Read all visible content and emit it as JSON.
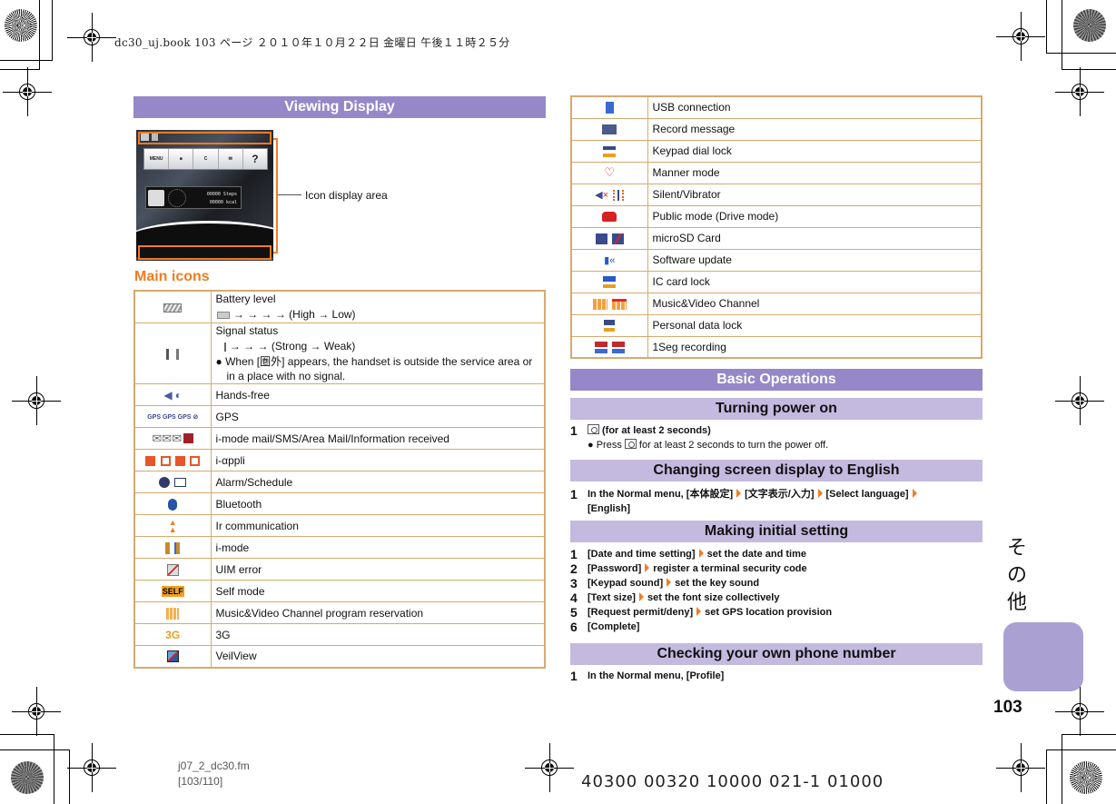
{
  "print_header": "dc30_uj.book   103 ページ   ２０１０年１０月２２日   金曜日   午後１１時２５分",
  "viewing_display": {
    "banner": "Viewing Display",
    "phone_menu": [
      "MENU",
      "■",
      "C",
      "✉",
      "?"
    ],
    "widget_steps": "00000 Steps",
    "widget_kcal": "00000 kcal",
    "callout_label": "Icon display area"
  },
  "main_icons": {
    "title": "Main icons",
    "rows": [
      {
        "icon": "battery-icon",
        "label": "Battery level",
        "sub": "→ → → →  (High → Low)"
      },
      {
        "icon": "signal-icon",
        "label": "Signal status",
        "sub": "→ → →  (Strong → Weak)",
        "note": "When [圏外] appears, the handset is outside the service area or in a place with no signal."
      },
      {
        "icon": "hands-free-icon",
        "label": "Hands-free"
      },
      {
        "icon": "gps-icon",
        "label": "GPS"
      },
      {
        "icon": "mail-icon",
        "label": "i-mode mail/SMS/Area Mail/Information received"
      },
      {
        "icon": "i-appli-icon",
        "label": "i-αppli"
      },
      {
        "icon": "alarm-icon",
        "label": "Alarm/Schedule"
      },
      {
        "icon": "bluetooth-icon",
        "label": "Bluetooth"
      },
      {
        "icon": "ir-icon",
        "label": "Ir communication"
      },
      {
        "icon": "i-mode-icon",
        "label": "i-mode"
      },
      {
        "icon": "uim-error-icon",
        "label": "UIM error"
      },
      {
        "icon": "self-mode-icon",
        "label": "Self mode"
      },
      {
        "icon": "program-reservation-icon",
        "label": "Music&Video Channel program reservation"
      },
      {
        "icon": "3g-icon",
        "label": "3G"
      },
      {
        "icon": "veilview-icon",
        "label": "VeilView"
      }
    ]
  },
  "more_icons": [
    {
      "icon": "usb-icon",
      "label": "USB connection"
    },
    {
      "icon": "record-message-icon",
      "label": "Record message"
    },
    {
      "icon": "keypad-lock-icon",
      "label": "Keypad dial lock"
    },
    {
      "icon": "manner-mode-icon",
      "label": "Manner mode"
    },
    {
      "icon": "silent-vibrator-icon",
      "label": "Silent/Vibrator"
    },
    {
      "icon": "public-mode-icon",
      "label": "Public mode (Drive mode)"
    },
    {
      "icon": "microsd-icon",
      "label": "microSD Card"
    },
    {
      "icon": "software-update-icon",
      "label": "Software update"
    },
    {
      "icon": "ic-card-lock-icon",
      "label": "IC card lock"
    },
    {
      "icon": "music-video-channel-icon",
      "label": "Music&Video Channel"
    },
    {
      "icon": "personal-data-lock-icon",
      "label": "Personal data lock"
    },
    {
      "icon": "1seg-recording-icon",
      "label": "1Seg recording"
    }
  ],
  "basic_operations": {
    "banner": "Basic Operations",
    "power_on": {
      "title": "Turning power on",
      "step1": "(for at least 2 seconds)",
      "note_pre": "Press",
      "note_post": "for at least 2 seconds to turn the power off."
    },
    "english": {
      "title": "Changing screen display to English",
      "step1_parts": [
        "In the Normal menu, [本体設定]",
        "[文字表示/入力]",
        "[Select language]"
      ],
      "step1_end": "[English]"
    },
    "initial": {
      "title": "Making initial setting",
      "steps": [
        {
          "n": "1",
          "a": "[Date and time setting]",
          "b": "set the date and time"
        },
        {
          "n": "2",
          "a": "[Password]",
          "b": "register a terminal security code"
        },
        {
          "n": "3",
          "a": "[Keypad sound]",
          "b": "set the key sound"
        },
        {
          "n": "4",
          "a": "[Text size]",
          "b": "set the font size collectively"
        },
        {
          "n": "5",
          "a": "[Request permit/deny]",
          "b": "set GPS location provision"
        },
        {
          "n": "6",
          "a": "[Complete]",
          "b": ""
        }
      ]
    },
    "phone_number": {
      "title": "Checking your own phone number",
      "step1": "In the Normal menu, [Profile]"
    }
  },
  "side_tab": {
    "label_chars": [
      "そ",
      "の",
      "他"
    ],
    "color": "#aba0d2"
  },
  "page_number": "103",
  "footer": {
    "file": "j07_2_dc30.fm",
    "pages": "[103/110]",
    "code": "40300 00320 10000 021-1  01000"
  },
  "colors": {
    "banner": "#9688c8",
    "sub_banner": "#c4badf",
    "accent": "#f07c22",
    "table_border": "#d6aa6e"
  }
}
